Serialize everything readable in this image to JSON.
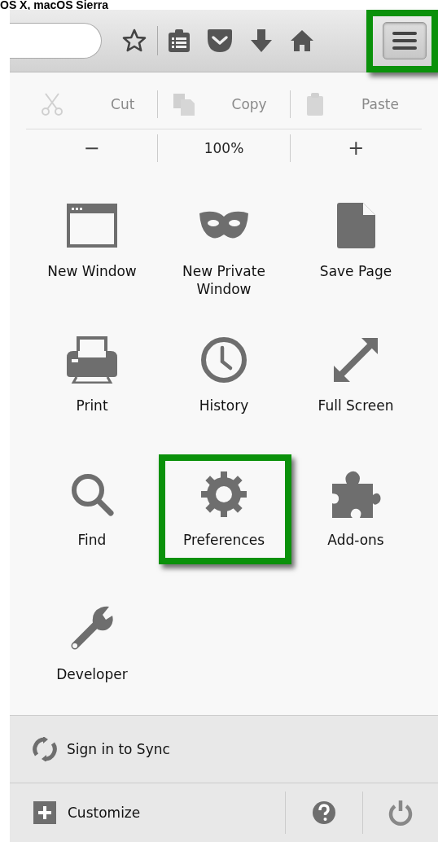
{
  "caption": "OS X, macOS Sierra",
  "toolbar": {
    "menu_button": {
      "highlighted": true
    }
  },
  "edit_controls": [
    {
      "label": "Cut",
      "disabled": true
    },
    {
      "label": "Copy",
      "disabled": true
    },
    {
      "label": "Paste",
      "disabled": true
    }
  ],
  "zoom_controls": [
    "−",
    "100%",
    "+"
  ],
  "menu_items": [
    {
      "label": "New Window",
      "highlighted": false
    },
    {
      "label": "New Private Window",
      "highlighted": false
    },
    {
      "label": "Save Page",
      "highlighted": false
    },
    {
      "label": "Print",
      "highlighted": false
    },
    {
      "label": "History",
      "highlighted": false
    },
    {
      "label": "Full Screen",
      "highlighted": false
    },
    {
      "label": "Find",
      "highlighted": false
    },
    {
      "label": "Preferences",
      "highlighted": true
    },
    {
      "label": "Add-ons",
      "highlighted": false
    },
    {
      "label": "Developer",
      "highlighted": false
    }
  ],
  "sync": {
    "label": "Sign in to Sync"
  },
  "footer": {
    "customize": "Customize"
  }
}
